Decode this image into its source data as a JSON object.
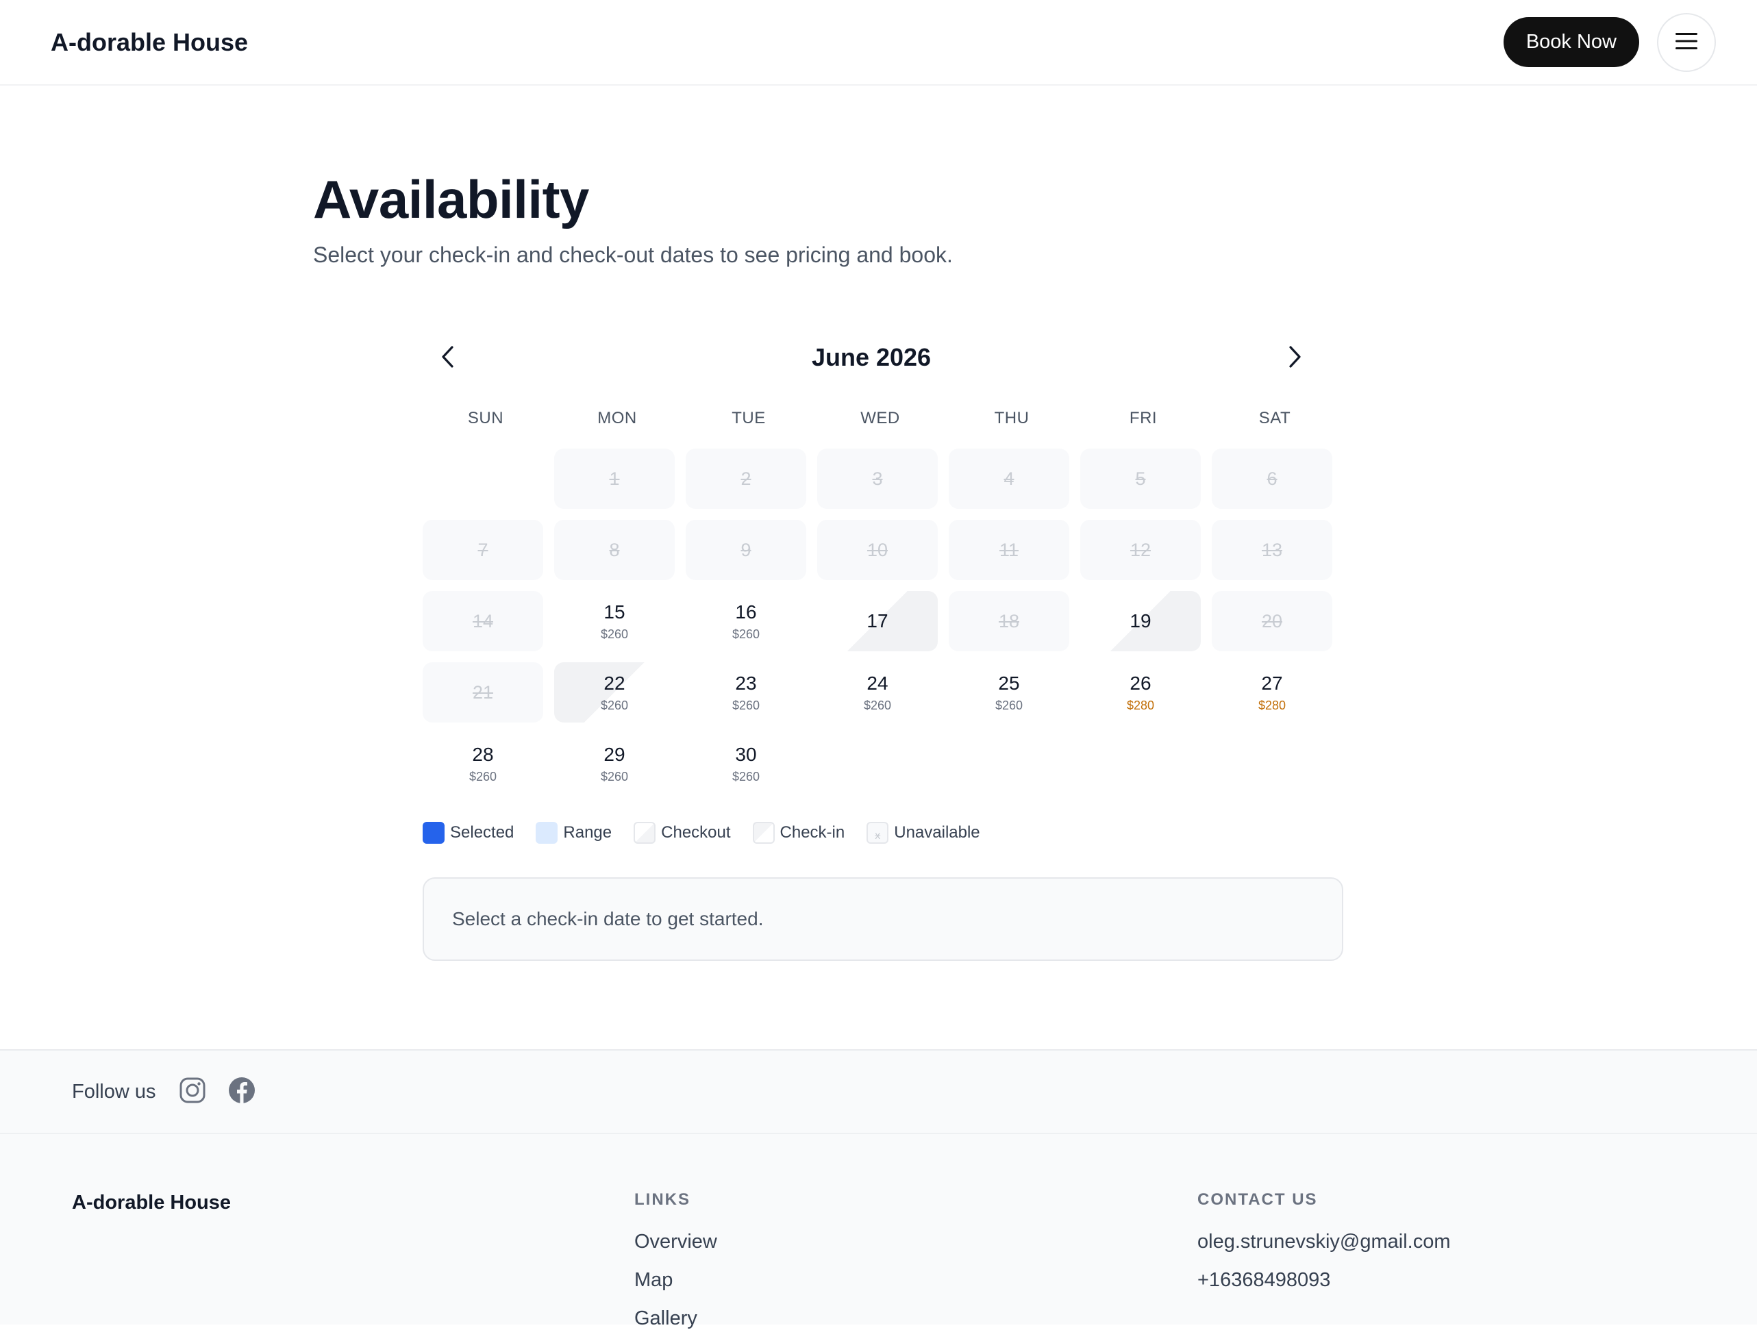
{
  "header": {
    "brand": "A-dorable House",
    "book_label": "Book Now",
    "menu_icon": "menu-icon"
  },
  "hero": {
    "title": "Availability",
    "subtitle": "Select your check-in and check-out dates to see pricing and book."
  },
  "calendar": {
    "month": "June 2026",
    "prev_icon": "chevron-left-icon",
    "next_icon": "chevron-right-icon",
    "weekdays": [
      "SUN",
      "MON",
      "TUE",
      "WED",
      "THU",
      "FRI",
      "SAT"
    ],
    "days": [
      {
        "n": "1",
        "s": "unavailable"
      },
      {
        "n": "2",
        "s": "unavailable"
      },
      {
        "n": "3",
        "s": "unavailable"
      },
      {
        "n": "4",
        "s": "unavailable"
      },
      {
        "n": "5",
        "s": "unavailable"
      },
      {
        "n": "6",
        "s": "unavailable"
      },
      {
        "n": "7",
        "s": "unavailable"
      },
      {
        "n": "8",
        "s": "unavailable"
      },
      {
        "n": "9",
        "s": "unavailable"
      },
      {
        "n": "10",
        "s": "unavailable"
      },
      {
        "n": "11",
        "s": "unavailable"
      },
      {
        "n": "12",
        "s": "unavailable"
      },
      {
        "n": "13",
        "s": "unavailable"
      },
      {
        "n": "14",
        "s": "unavailable"
      },
      {
        "n": "15",
        "s": "available",
        "price": "$260"
      },
      {
        "n": "16",
        "s": "available",
        "price": "$260"
      },
      {
        "n": "17",
        "s": "checkout"
      },
      {
        "n": "18",
        "s": "unavailable"
      },
      {
        "n": "19",
        "s": "checkout"
      },
      {
        "n": "20",
        "s": "unavailable"
      },
      {
        "n": "21",
        "s": "unavailable"
      },
      {
        "n": "22",
        "s": "checkin",
        "price": "$260"
      },
      {
        "n": "23",
        "s": "available",
        "price": "$260"
      },
      {
        "n": "24",
        "s": "available",
        "price": "$260"
      },
      {
        "n": "25",
        "s": "available",
        "price": "$260"
      },
      {
        "n": "26",
        "s": "available",
        "price": "$280",
        "high": true
      },
      {
        "n": "27",
        "s": "available",
        "price": "$280",
        "high": true
      },
      {
        "n": "28",
        "s": "available",
        "price": "$260"
      },
      {
        "n": "29",
        "s": "available",
        "price": "$260"
      },
      {
        "n": "30",
        "s": "available",
        "price": "$260"
      }
    ]
  },
  "legend": {
    "selected": "Selected",
    "range": "Range",
    "checkout": "Checkout",
    "checkin": "Check-in",
    "unavailable": "Unavailable",
    "unavailable_glyph": "x",
    "selected_color": "#2563eb",
    "range_color": "#dbeafe"
  },
  "info": {
    "message": "Select a check-in date to get started."
  },
  "footer": {
    "follow_label": "Follow us",
    "social_icons": [
      "instagram-icon",
      "facebook-icon"
    ],
    "brand": "A-dorable House",
    "links_heading": "LINKS",
    "links": [
      "Overview",
      "Map",
      "Gallery"
    ],
    "contact_heading": "CONTACT US",
    "email": "oleg.strunevskiy@gmail.com",
    "phone": "+16368498093"
  },
  "colors": {
    "accent_dark": "#111111",
    "price_high": "#c2700a"
  }
}
